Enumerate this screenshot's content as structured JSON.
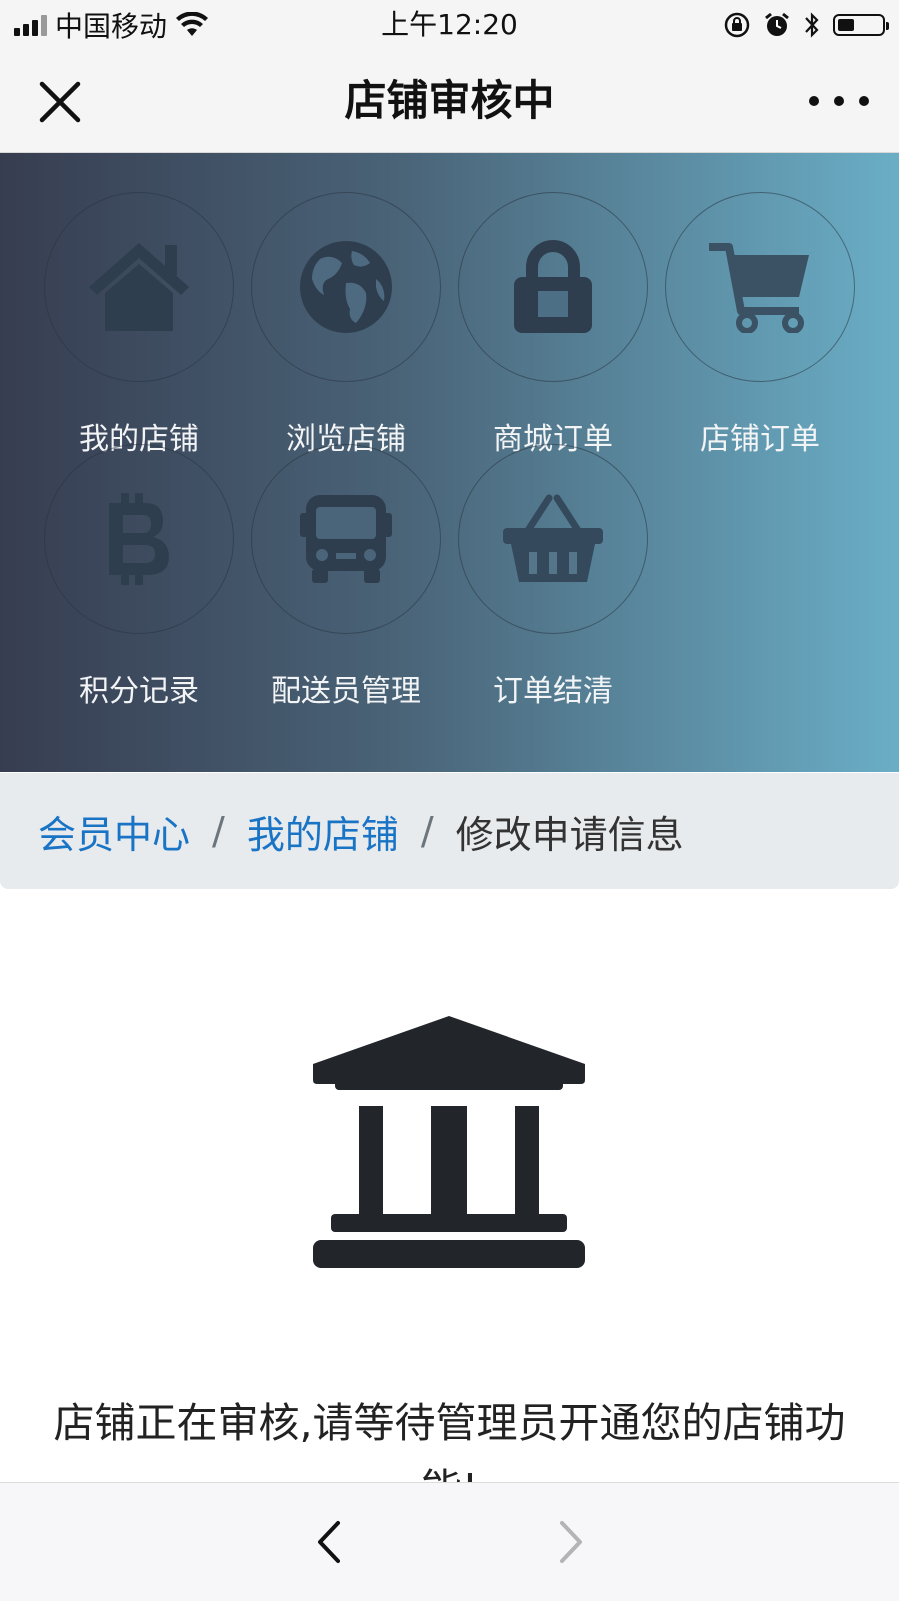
{
  "status_bar": {
    "carrier": "中国移动",
    "time": "上午12:20",
    "icons": [
      "signal-icon",
      "wifi-icon",
      "orientation-lock-icon",
      "alarm-icon",
      "bluetooth-icon",
      "battery-icon"
    ]
  },
  "nav": {
    "title": "店铺审核中",
    "close_icon": "close-icon",
    "more_icon": "more-icon"
  },
  "menu": {
    "items": [
      {
        "label": "我的店铺",
        "icon": "home-icon"
      },
      {
        "label": "浏览店铺",
        "icon": "globe-icon"
      },
      {
        "label": "商城订单",
        "icon": "lock-icon"
      },
      {
        "label": "店铺订单",
        "icon": "cart-icon"
      },
      {
        "label": "积分记录",
        "icon": "bitcoin-icon"
      },
      {
        "label": "配送员管理",
        "icon": "bus-icon"
      },
      {
        "label": "订单结清",
        "icon": "basket-icon"
      }
    ]
  },
  "breadcrumb": {
    "items": [
      {
        "label": "会员中心",
        "active": false
      },
      {
        "label": "我的店铺",
        "active": false
      },
      {
        "label": "修改申请信息",
        "active": true
      }
    ],
    "separator": "/"
  },
  "main": {
    "icon": "bank-icon",
    "message": "店铺正在审核,请等待管理员开通您的店铺功能!"
  },
  "toolbar": {
    "back_icon": "chevron-left-icon",
    "forward_icon": "chevron-right-icon"
  },
  "colors": {
    "hero_gradient_start": "#373d51",
    "hero_gradient_end": "#6aaec6",
    "link": "#1a74c6",
    "icon_dark": "#2d3d4e",
    "breadcrumb_bg": "#e8ebee"
  }
}
